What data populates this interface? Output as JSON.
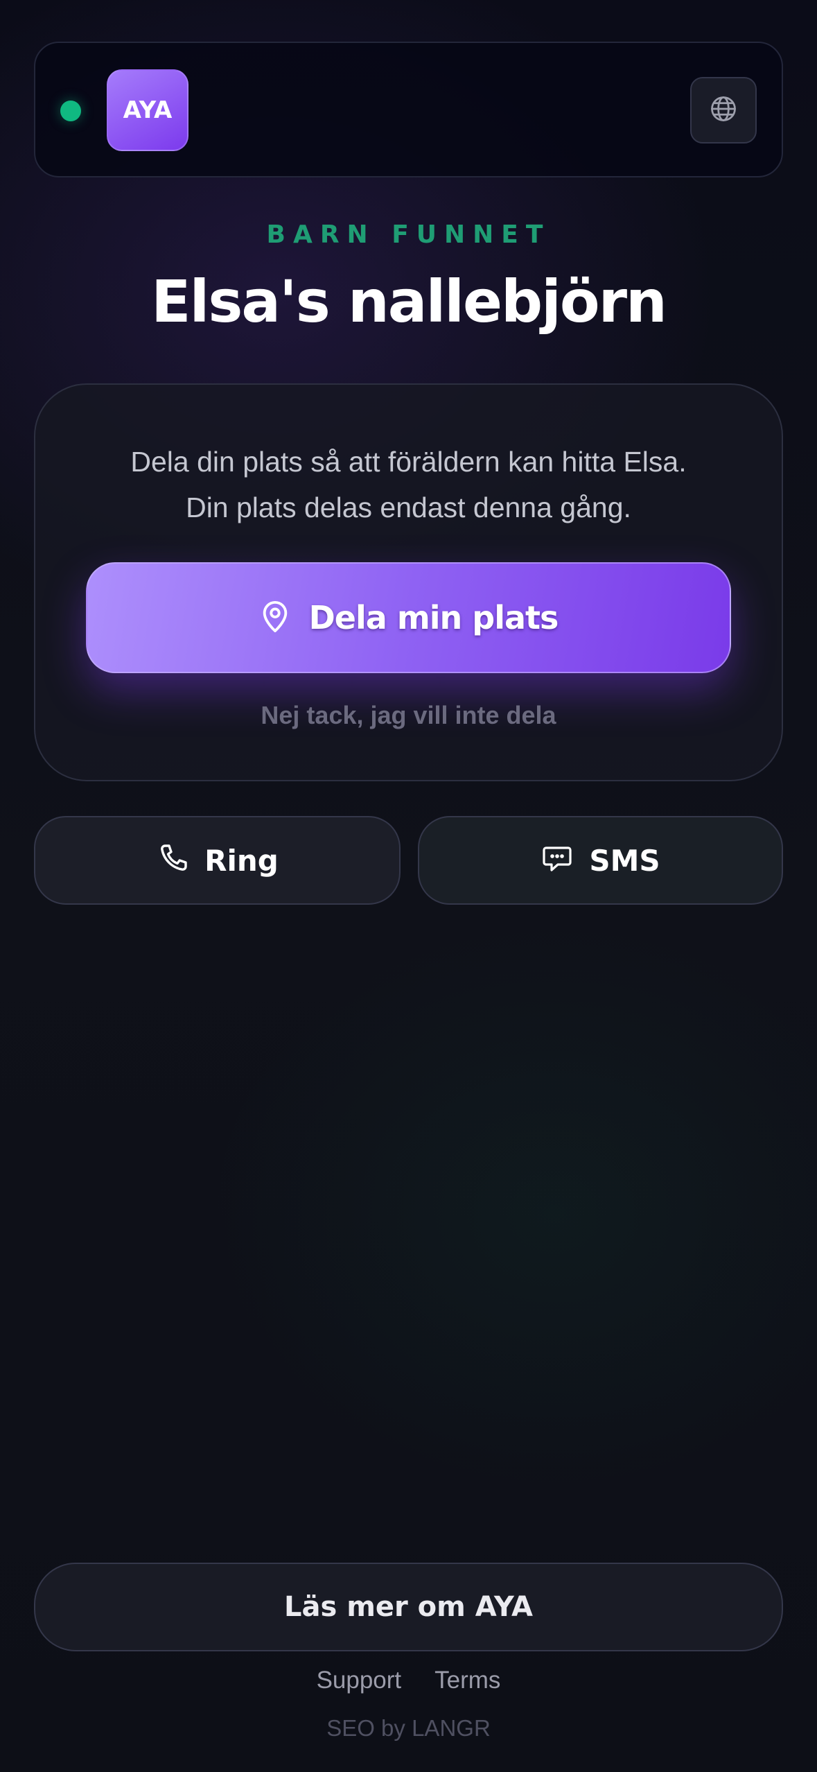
{
  "header": {
    "status": "online",
    "logo_text": "AYA",
    "language_icon": "globe-icon"
  },
  "hero": {
    "eyebrow": "BARN FUNNET",
    "title": "Elsa's nallebjörn"
  },
  "share_card": {
    "description_line1": "Dela din plats så att föräldern kan hitta Elsa.",
    "description_line2": "Din plats delas endast denna gång.",
    "share_button_label": "Dela min plats",
    "share_button_icon": "map-pin-icon",
    "decline_label": "Nej tack, jag vill inte dela"
  },
  "contact": {
    "call_label": "Ring",
    "call_icon": "phone-icon",
    "sms_label": "SMS",
    "sms_icon": "chat-bubble-icon"
  },
  "footer": {
    "read_more_label": "Läs mer om AYA",
    "links": [
      "Support",
      "Terms"
    ],
    "credit": "SEO by LANGR"
  },
  "colors": {
    "accent_purple": "#8b5cf6",
    "status_green": "#10b981",
    "eyebrow_green": "#1f9d74",
    "background": "#0d0f18"
  }
}
